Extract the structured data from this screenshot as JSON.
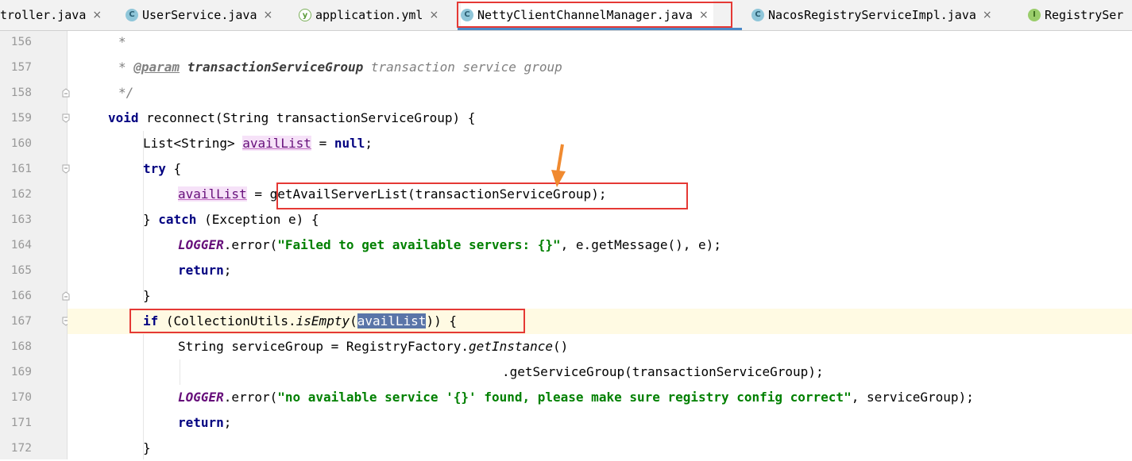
{
  "tabs": [
    {
      "label": "troller.java",
      "icon": "class-icon",
      "closable": true
    },
    {
      "label": "UserService.java",
      "icon": "class-icon",
      "closable": true
    },
    {
      "label": "application.yml",
      "icon": "yml-file-icon",
      "closable": true
    },
    {
      "label": "NettyClientChannelManager.java",
      "icon": "class-icon",
      "closable": true,
      "active": true
    },
    {
      "label": "NacosRegistryServiceImpl.java",
      "icon": "class-icon",
      "closable": true
    },
    {
      "label": "RegistrySer",
      "icon": "interface-icon",
      "closable": false
    }
  ],
  "close_glyph": "×",
  "icon_letters": {
    "class": "C",
    "interface": "I",
    "yml": "y"
  },
  "line_numbers": [
    "156",
    "157",
    "158",
    "159",
    "160",
    "161",
    "162",
    "163",
    "164",
    "165",
    "166",
    "167",
    "168",
    "169",
    "170",
    "171",
    "172"
  ],
  "code": {
    "l156_star": "*",
    "l157_star": "* ",
    "l157_tag": "@param",
    "l157_name": "transactionServiceGroup",
    "l157_desc": " transaction service group",
    "l158": "*/",
    "l159_kw": "void",
    "l159_rest": " reconnect(String transactionServiceGroup) {",
    "l160_a": "List<String> ",
    "l160_var": "availList",
    "l160_b": " = ",
    "l160_kw": "null",
    "l160_c": ";",
    "l161_kw": "try",
    "l161_rest": " {",
    "l162_var": "availList",
    "l162_b": " = ",
    "l162_c": "getAvailServerList(transactionServiceGroup);",
    "l163_a": "} ",
    "l163_kw": "catch",
    "l163_rest": " (Exception e) {",
    "l164_f": "LOGGER",
    "l164_a": ".error(",
    "l164_str": "\"Failed to get available servers: {}\"",
    "l164_b": ", e.getMessage(), e);",
    "l165_kw": "return",
    "l165_rest": ";",
    "l166": "}",
    "l167_kw": "if",
    "l167_a": " (CollectionUtils.",
    "l167_m": "isEmpty",
    "l167_b": "(",
    "l167_sel": "availList",
    "l167_c": ")) {",
    "l168_a": "String serviceGroup = RegistryFactory.",
    "l168_m": "getInstance",
    "l168_b": "()",
    "l169": ".getServiceGroup(transactionServiceGroup);",
    "l170_f": "LOGGER",
    "l170_a": ".error(",
    "l170_str": "\"no available service '{}' found, please make sure registry config correct\"",
    "l170_b": ", serviceGroup);",
    "l171_kw": "return",
    "l171_rest": ";",
    "l172": "}"
  },
  "colors": {
    "annotation": "#e53935",
    "arrow": "#f08a30",
    "selection": "#5a75a8",
    "current_line": "#fffae3",
    "keyword": "#000080",
    "string": "#008000",
    "static_field": "#660e7a"
  }
}
